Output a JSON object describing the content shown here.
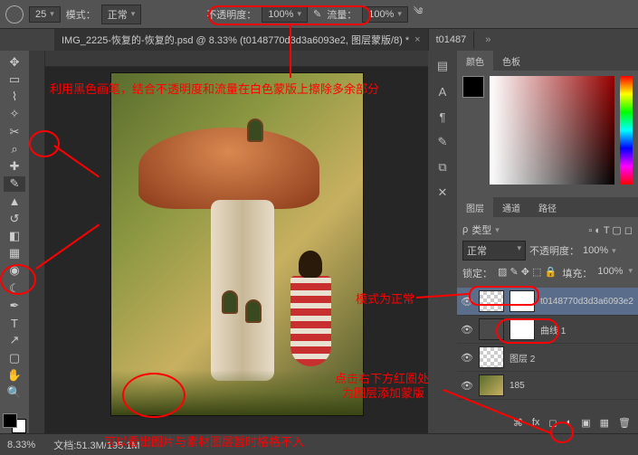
{
  "topbar": {
    "brush_size": "25",
    "mode_label": "模式：",
    "mode_value": "正常",
    "opacity_label": "不透明度：",
    "opacity_value": "100%",
    "flow_label": "流量：",
    "flow_value": "100%"
  },
  "tabs": [
    {
      "label": "IMG_2225-恢复的-恢复的.psd @ 8.33% (t0148770d3d3a6093e2, 图层蒙版/8) *"
    },
    {
      "label": "t01487"
    }
  ],
  "status": {
    "zoom": "8.33%",
    "docsize": "文档:51.3M/195.1M"
  },
  "panel_color": {
    "tab1": "颜色",
    "tab2": "色板"
  },
  "layers": {
    "tab1": "图层",
    "tab2": "通道",
    "tab3": "路径",
    "kind": "类型",
    "blend_mode": "正常",
    "opacity_label": "不透明度：",
    "opacity": "100%",
    "lock_label": "锁定：",
    "fill_label": "填充：",
    "fill": "100%",
    "items": [
      {
        "name": "t0148770d3d3a6093e2",
        "mask": true
      },
      {
        "name": "曲线 1",
        "adj": true
      },
      {
        "name": "图层 2"
      },
      {
        "name": "185"
      }
    ]
  },
  "annotations": {
    "a1": "利用黑色画笔，结合不透明度和流量在白色蒙版上擦除多余部分",
    "a2": "模式为正常",
    "a3": "点击右下方红圈处",
    "a4": "为图层添加蒙版",
    "a5": "可以看出图片与素材图层暂时格格不入"
  }
}
